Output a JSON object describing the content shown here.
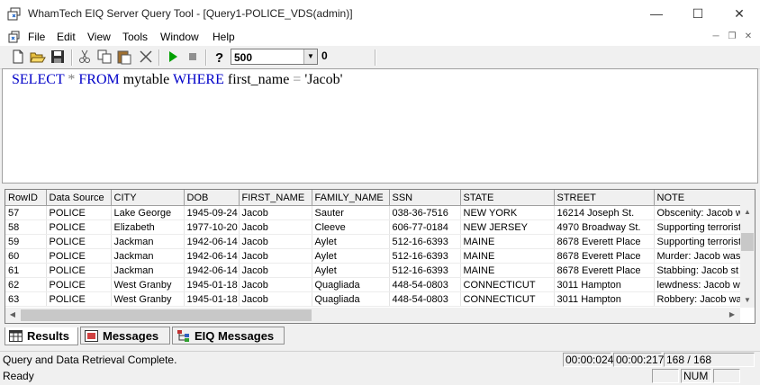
{
  "window": {
    "title": "WhamTech EIQ Server Query Tool - [Query1-POLICE_VDS(admin)]",
    "minimize": "—",
    "maximize": "☐",
    "close": "✕"
  },
  "menu": {
    "items": [
      "File",
      "Edit",
      "View",
      "Tools",
      "Window",
      "Help"
    ]
  },
  "toolbar": {
    "row_limit": "500",
    "counter": "0",
    "icons": [
      "new-file-icon",
      "open-folder-icon",
      "save-icon",
      "cut-icon",
      "copy-icon",
      "paste-icon",
      "delete-icon",
      "run-icon",
      "stop-icon",
      "help-icon"
    ]
  },
  "editor": {
    "sql_parts": {
      "select": "SELECT",
      "star": "*",
      "from": "FROM",
      "table": "mytable",
      "where": "WHERE",
      "column": "first_name",
      "equals": "=",
      "value": "'Jacob'"
    }
  },
  "grid": {
    "columns": [
      "RowID",
      "Data Source",
      "CITY",
      "DOB",
      "FIRST_NAME",
      "FAMILY_NAME",
      "SSN",
      "STATE",
      "STREET",
      "NOTE"
    ],
    "rows": [
      [
        "57",
        "POLICE",
        "Lake George",
        "1945-09-24",
        "Jacob",
        "Sauter",
        "038-36-7516",
        "NEW YORK",
        "16214 Joseph St.",
        "Obscenity: Jacob w"
      ],
      [
        "58",
        "POLICE",
        "Elizabeth",
        "1977-10-20",
        "Jacob",
        "Cleeve",
        "606-77-0184",
        "NEW JERSEY",
        "4970 Broadway St.",
        "Supporting terrorists"
      ],
      [
        "59",
        "POLICE",
        "Jackman",
        "1942-06-14",
        "Jacob",
        "Aylet",
        "512-16-6393",
        "MAINE",
        "8678 Everett Place",
        "Supporting terrorists"
      ],
      [
        "60",
        "POLICE",
        "Jackman",
        "1942-06-14",
        "Jacob",
        "Aylet",
        "512-16-6393",
        "MAINE",
        "8678 Everett Place",
        "Murder: Jacob was"
      ],
      [
        "61",
        "POLICE",
        "Jackman",
        "1942-06-14",
        "Jacob",
        "Aylet",
        "512-16-6393",
        "MAINE",
        "8678 Everett Place",
        "Stabbing: Jacob st"
      ],
      [
        "62",
        "POLICE",
        "West Granby",
        "1945-01-18",
        "Jacob",
        "Quagliada",
        "448-54-0803",
        "CONNECTICUT",
        "3011 Hampton",
        "lewdness: Jacob w"
      ],
      [
        "63",
        "POLICE",
        "West Granby",
        "1945-01-18",
        "Jacob",
        "Quagliada",
        "448-54-0803",
        "CONNECTICUT",
        "3011 Hampton",
        "Robbery: Jacob wa"
      ]
    ]
  },
  "tabs": [
    "Results",
    "Messages",
    "EIQ Messages"
  ],
  "status": {
    "message": "Query and Data Retrieval Complete.",
    "elapsed1": "00:00:024",
    "elapsed2": "00:00:217",
    "rows": "168 / 168",
    "ready": "Ready",
    "num": "NUM"
  },
  "colors": {
    "keyword": "#0000c8",
    "operator": "#808080",
    "run_green": "#00a000"
  }
}
